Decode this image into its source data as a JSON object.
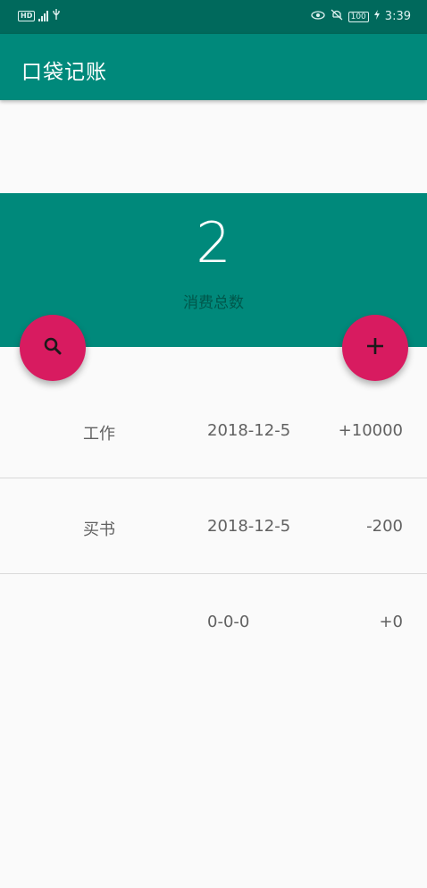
{
  "status_bar": {
    "left_icons": [
      "hd-icon",
      "4g-signal-icon",
      "usb-icon"
    ],
    "hd_label": "HD",
    "right_icons": [
      "eye-icon",
      "mute-icon",
      "battery-icon",
      "charging-icon"
    ],
    "battery": "100",
    "time": "3:39"
  },
  "app_bar": {
    "title": "口袋记账"
  },
  "summary": {
    "total": "2",
    "label": "消费总数"
  },
  "fabs": {
    "search_icon": "search-icon",
    "add_icon": "add-icon"
  },
  "records": [
    {
      "name": "工作",
      "date": "2018-12-5",
      "amount": "+10000"
    },
    {
      "name": "买书",
      "date": "2018-12-5",
      "amount": "-200"
    },
    {
      "name": "",
      "date": "0-0-0",
      "amount": "+0"
    }
  ],
  "colors": {
    "status_bar": "#00695c",
    "primary": "#00897b",
    "accent": "#d81b60",
    "background": "#fafafa"
  }
}
